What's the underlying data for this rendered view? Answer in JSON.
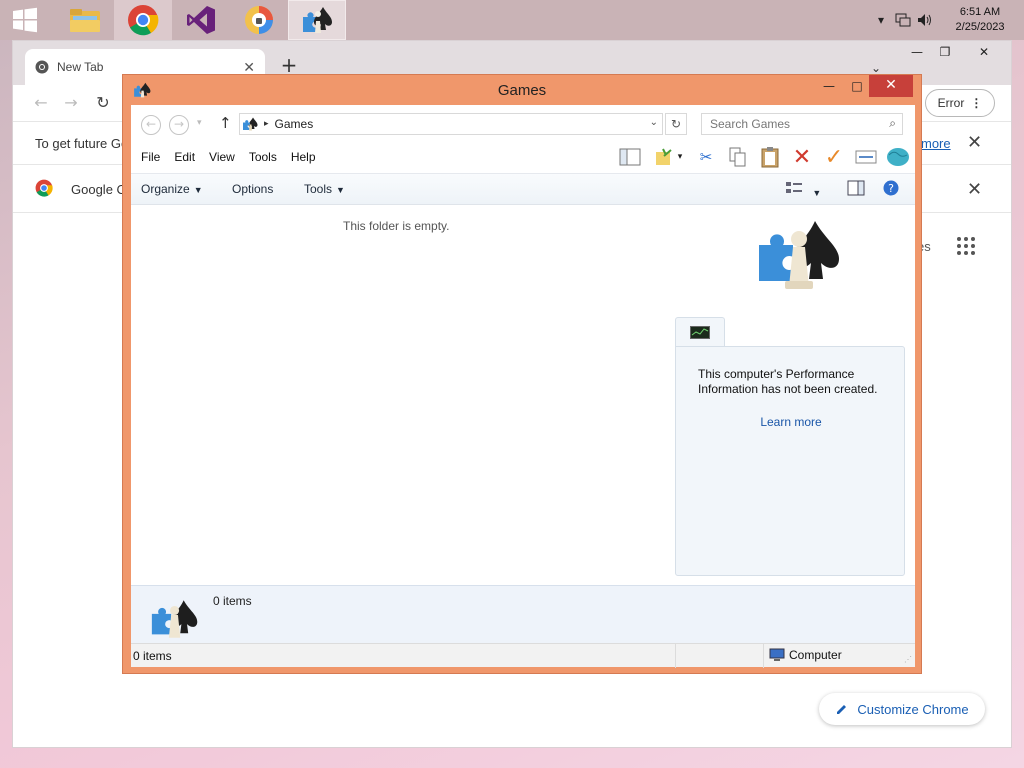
{
  "taskbar": {
    "apps": [
      "file-explorer",
      "chrome",
      "visual-studio",
      "security-app",
      "games"
    ],
    "tray": {
      "time": "6:51 AM",
      "date": "2/25/2023"
    }
  },
  "chrome": {
    "tab_title": "New Tab",
    "error_label": "Error",
    "info_bar_text": "To get future Ge",
    "info_bar_link": "more",
    "bookmark_text": "Google C",
    "apps_partial": "es",
    "customize_label": "Customize Chrome"
  },
  "explorer": {
    "title": "Games",
    "address_crumb": "Games",
    "search_placeholder": "Search Games",
    "menu": [
      "File",
      "Edit",
      "View",
      "Tools",
      "Help"
    ],
    "commands": {
      "organize": "Organize",
      "options": "Options",
      "tools": "Tools"
    },
    "empty_text": "This folder is empty.",
    "perf_text": "This computer's Performance Information has not been created.",
    "perf_link": "Learn more",
    "details_count": "0 items",
    "status_count": "0 items",
    "status_location": "Computer",
    "colors": {
      "frame": "#f0976b",
      "close": "#c7403a",
      "link": "#1a56a8"
    }
  }
}
